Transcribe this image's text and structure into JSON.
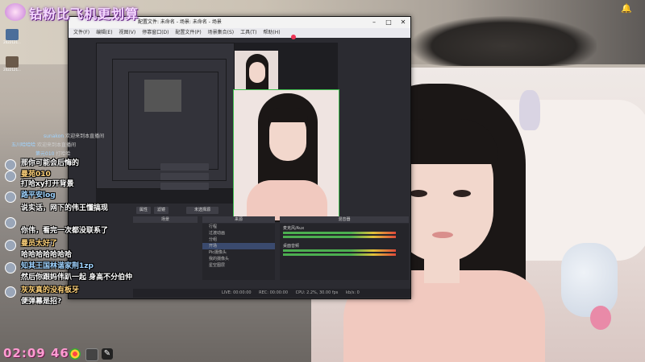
{
  "banner": {
    "text": "钻粉比飞机更划算"
  },
  "desktop_icons": [
    {
      "label": "2022121..."
    },
    {
      "label": "2022121..."
    }
  ],
  "obs": {
    "title": "配置文件: 未命名 - 场景: 未命名 - 场景",
    "menu": [
      "文件(F)",
      "编辑(E)",
      "视图(V)",
      "停靠窗口(D)",
      "配置文件(P)",
      "场景集合(S)",
      "工具(T)",
      "帮助(H)"
    ],
    "preview_labels": {
      "properties": "属性",
      "filters": "滤镜",
      "no_source": "未选择源"
    },
    "docks": {
      "scenes": "场景",
      "sources": "来源",
      "mixer": "混音器"
    },
    "sources": [
      "行程",
      "过渡动画",
      "分组",
      "开场",
      "Pic摄像头",
      "我的摄像头",
      "星空图层"
    ],
    "mixer_channels": [
      "麦克风/Aux",
      "桌面音频"
    ],
    "status": {
      "live_time": "LIVE: 00:00:00",
      "rec": "REC: 00:00:00",
      "cpu": "CPU: 2.2%, 30.00 fps",
      "kbps": "kb/s: 0"
    }
  },
  "chat": {
    "top_messages": [
      {
        "user": "sunakon",
        "text": "欢迎来到本直播间"
      },
      {
        "user": "五川哈哈哈",
        "text": "欢迎来到本直播间"
      },
      {
        "user": "第元010",
        "text": "打哈哈"
      }
    ],
    "messages": [
      {
        "text": "那你可能会后悔的",
        "color": "#ffffff"
      },
      {
        "user": "曼苑010",
        "text": "",
        "color": "#ffd27a"
      },
      {
        "text": "打哈xy打开背景",
        "color": "#ffffff"
      },
      {
        "user": "路平安log",
        "text": "",
        "color": "#9fd3ff"
      },
      {
        "text": "说实话，网下的伟王懂搞现",
        "color": "#ffffff"
      },
      {
        "text": "你伟，看完一次都没联系了",
        "color": "#ffffff"
      },
      {
        "user": "曼员太好了",
        "text": "",
        "color": "#ffd27a"
      },
      {
        "text": "哈哈哈哈哈哈哈",
        "color": "#ffffff"
      },
      {
        "user": "知其王国林谐家荆1zp",
        "text": "",
        "color": "#9fd3ff"
      },
      {
        "text": "然后你跟妈伟趴一起  身高不分伯仲",
        "color": "#ffffff"
      },
      {
        "user": "灰灰真的没有板牙",
        "text": "",
        "color": "#ffd27a"
      },
      {
        "text": "便弹幕是招?",
        "color": "#ffffff"
      }
    ]
  },
  "taskbar": {
    "clock": "02:09 46"
  }
}
